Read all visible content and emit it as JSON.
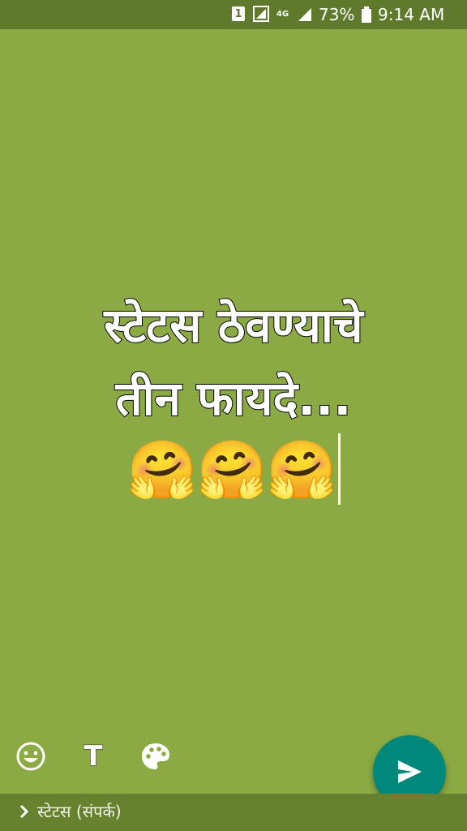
{
  "status_bar": {
    "sim": "1",
    "network": "4G",
    "battery": "73%",
    "time": "9:14 AM"
  },
  "status_text": {
    "line1": "स्टेटस ठेवण्याचे",
    "line2": "तीन फायदे...",
    "emoji": "🤗"
  },
  "tools": {
    "text_tool_label": "T"
  },
  "audience": {
    "label": "स्टेटस (संपर्क)"
  },
  "icons": {
    "emoji_tool": "smiley-icon",
    "text_tool": "text-icon",
    "palette_tool": "palette-icon",
    "send": "send-icon",
    "audience": "chevron-right-icon"
  },
  "colors": {
    "background": "#8baa43",
    "status_bar": "#5f7a2c",
    "send_button": "#00897b",
    "audience_bar": "#66822f"
  }
}
